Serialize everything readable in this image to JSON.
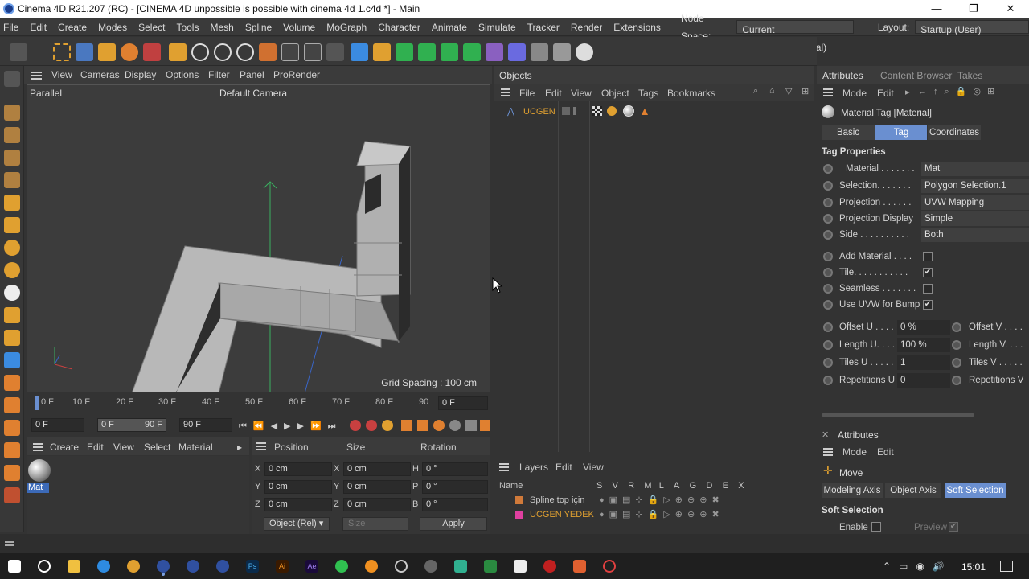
{
  "window": {
    "title": "Cinema 4D R21.207 (RC) - [CINEMA 4D unpossible is possible with cinema 4d 1.c4d *] - Main",
    "minimize": "—",
    "maximize": "❐",
    "close": "✕"
  },
  "menu": {
    "items": [
      "File",
      "Edit",
      "Create",
      "Modes",
      "Select",
      "Tools",
      "Mesh",
      "Spline",
      "Volume",
      "MoGraph",
      "Character",
      "Animate",
      "Simulate",
      "Tracker",
      "Render",
      "Extensions"
    ],
    "node_space_label": "Node Space:",
    "node_space_value": "Current (Standard/Physical)",
    "layout_label": "Layout:",
    "layout_value": "Startup (User)"
  },
  "viewport": {
    "menu": [
      "View",
      "Cameras",
      "Display",
      "Options",
      "Filter",
      "Panel",
      "ProRender"
    ],
    "projection": "Parallel",
    "camera": "Default Camera",
    "grid_spacing": "Grid Spacing : 100 cm"
  },
  "timeline": {
    "ticks": [
      "0 F",
      "10 F",
      "20 F",
      "30 F",
      "40 F",
      "50 F",
      "60 F",
      "70 F",
      "80 F",
      "90"
    ],
    "current_frame": "0 F",
    "start": "0 F",
    "range_start": "0 F",
    "range_end": "90 F",
    "end": "90 F"
  },
  "materials": {
    "menu": [
      "Create",
      "Edit",
      "View",
      "Select",
      "Material"
    ],
    "items": [
      {
        "name": "Mat"
      }
    ]
  },
  "coordinates": {
    "headers": [
      "Position",
      "Size",
      "Rotation"
    ],
    "rows": [
      {
        "axis": "X",
        "pos": "0 cm",
        "size_axis": "X",
        "size": "0 cm",
        "rot_axis": "H",
        "rot": "0 °"
      },
      {
        "axis": "Y",
        "pos": "0 cm",
        "size_axis": "Y",
        "size": "0 cm",
        "rot_axis": "P",
        "rot": "0 °"
      },
      {
        "axis": "Z",
        "pos": "0 cm",
        "size_axis": "Z",
        "size": "0 cm",
        "rot_axis": "B",
        "rot": "0 °"
      }
    ],
    "mode": "Object (Rel)",
    "size_mode": "Size",
    "apply": "Apply"
  },
  "objects": {
    "title": "Objects",
    "menu": [
      "File",
      "Edit",
      "View",
      "Object",
      "Tags",
      "Bookmarks"
    ],
    "items": [
      {
        "name": "UCGEN"
      }
    ]
  },
  "layers": {
    "menu": [
      "Layers",
      "Edit",
      "View"
    ],
    "col_name": "Name",
    "cols": [
      "S",
      "V",
      "R",
      "M",
      "L",
      "A",
      "G",
      "D",
      "E",
      "X"
    ],
    "items": [
      {
        "name": "Spline top için",
        "color": "#d07a3a"
      },
      {
        "name": "UCGEN YEDEK",
        "color": "#e040a0"
      }
    ]
  },
  "attributes": {
    "tabs_top": [
      "Attributes",
      "Content Browser",
      "Takes"
    ],
    "menu": [
      "Mode",
      "Edit"
    ],
    "object_title": "Material Tag [Material]",
    "tabs": [
      "Basic",
      "Tag",
      "Coordinates"
    ],
    "active_tab": "Tag",
    "section": "Tag Properties",
    "props": [
      {
        "label": "Material . . . . . . .",
        "value": "Mat"
      },
      {
        "label": "Selection. . . . . . .",
        "value": "Polygon Selection.1"
      },
      {
        "label": "Projection . . . . . .",
        "value": "UVW Mapping"
      },
      {
        "label": "Projection Display",
        "value": "Simple"
      },
      {
        "label": "Side . . . . . . . . . .",
        "value": "Both"
      }
    ],
    "checks": [
      {
        "label": "Add Material . . . .",
        "checked": ""
      },
      {
        "label": "Tile. . . . . . . . . . .",
        "checked": "✔"
      },
      {
        "label": "Seamless . . . . . . .",
        "checked": ""
      },
      {
        "label": "Use UVW for Bump",
        "checked": "✔"
      }
    ],
    "uv": [
      {
        "label": "Offset U . . . .",
        "value": "0 %",
        "right": "Offset V . . . ."
      },
      {
        "label": "Length U. . . .",
        "value": "100 %",
        "right": "Length V. . . ."
      },
      {
        "label": "Tiles U . . . . .",
        "value": "1",
        "right": "Tiles V . . . . ."
      },
      {
        "label": "Repetitions U",
        "value": "0",
        "right": "Repetitions V"
      }
    ]
  },
  "attributes2": {
    "title": "Attributes",
    "menu": [
      "Mode",
      "Edit"
    ],
    "tool": "Move",
    "tabs": [
      "Modeling Axis",
      "Object Axis",
      "Soft Selection"
    ],
    "section": "Soft Selection",
    "enable": "Enable",
    "preview": "Preview"
  },
  "taskbar": {
    "time": "15:01"
  }
}
